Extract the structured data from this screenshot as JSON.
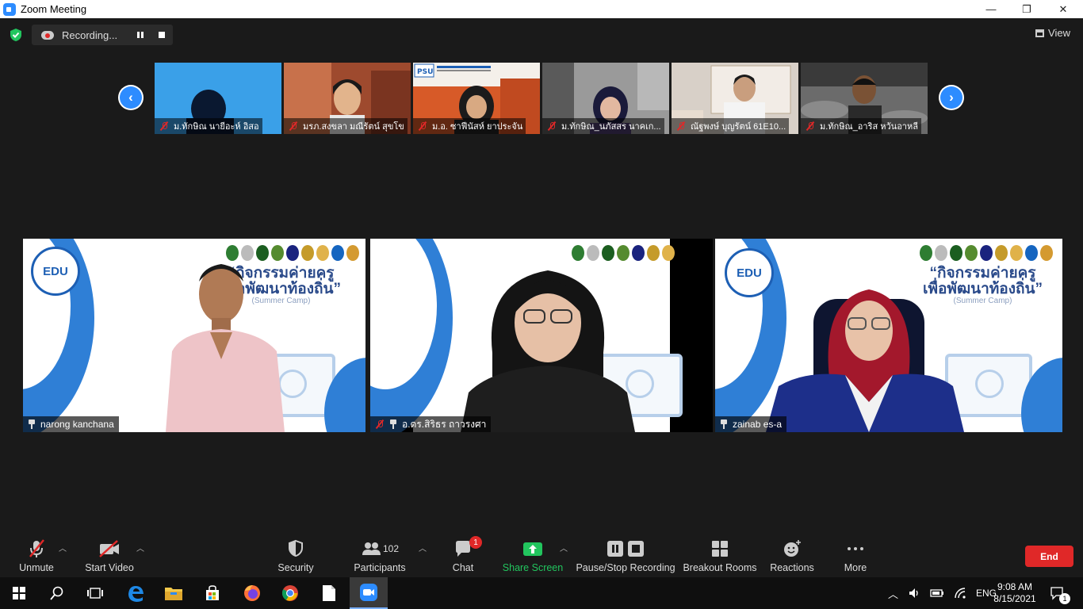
{
  "window": {
    "title": "Zoom Meeting",
    "minimize": "—",
    "restore": "❐",
    "close": "✕"
  },
  "top": {
    "recording_label": "Recording...",
    "view_label": "View"
  },
  "gallery_strip": {
    "prev_arrow": "‹",
    "next_arrow": "›",
    "thumbnails": [
      {
        "name": "ม.ทักษิณ นายีอะห์ อิสอ",
        "bg": "#3aa0e8"
      },
      {
        "name": "มรภ.สงขลา มณีรัตน์ สุขโข",
        "bg": "#b35a3c"
      },
      {
        "name": "ม.อ. ซาฟีนัสห์ ยาประจัน",
        "bg": "#e8e0d8"
      },
      {
        "name": "ม.ทักษิณ_นภัสสร นาคเก...",
        "bg": "#8a8a8a"
      },
      {
        "name": "ณัฐพงษ์ บุญรัตน์ 61E10...",
        "bg": "#d9d2cc"
      },
      {
        "name": "ม.ทักษิณ_อาริส หวันอาหลี",
        "bg": "#555555"
      }
    ]
  },
  "tiles": [
    {
      "name": "narong kanchana",
      "muted": false
    },
    {
      "name": "อ.ดร.สิริธร ถาวรงศา",
      "muted": true
    },
    {
      "name": "zainab es-a",
      "muted": false,
      "active": true
    }
  ],
  "slide": {
    "edu_logo": "EDU",
    "headline_1": "“กิจกรรมค่ายครู",
    "headline_2": "เพื่อพัฒนาท้องถิ่น”",
    "subline": "(Summer Camp)"
  },
  "toolbar": {
    "unmute": "Unmute",
    "start_video": "Start Video",
    "security": "Security",
    "participants": "Participants",
    "participants_count": "102",
    "chat": "Chat",
    "chat_badge": "1",
    "share_screen": "Share Screen",
    "pause_stop_recording": "Pause/Stop Recording",
    "breakout_rooms": "Breakout Rooms",
    "reactions": "Reactions",
    "more": "More",
    "end": "End"
  },
  "taskbar": {
    "language": "ENG",
    "time": "9:08 AM",
    "date": "8/15/2021",
    "notification_count": "1"
  },
  "colors": {
    "zoom_blue": "#2d8cff",
    "end_red": "#e02828",
    "share_green": "#22c55e",
    "active_border": "#d6e87a"
  }
}
